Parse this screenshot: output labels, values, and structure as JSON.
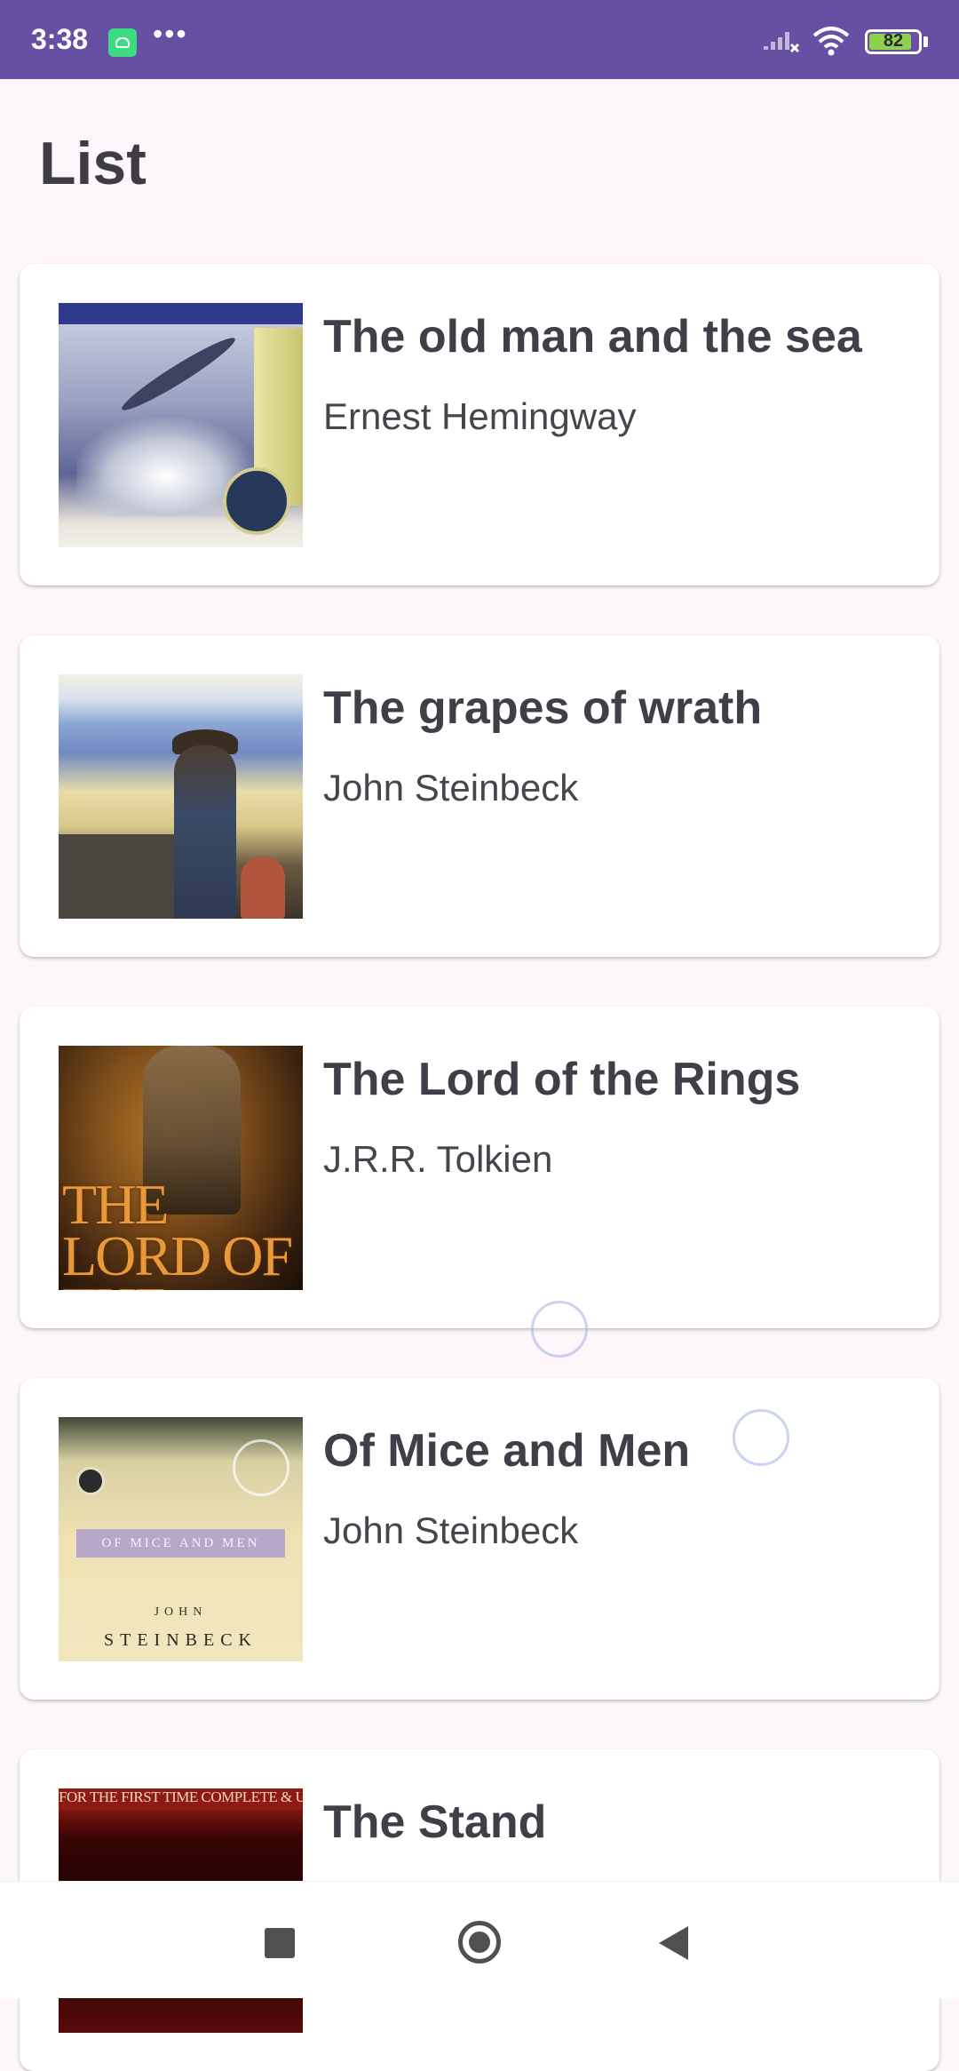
{
  "status_bar": {
    "time": "3:38",
    "overflow_indicator": "•••",
    "battery_level": "82",
    "icons": [
      "app-notification-icon",
      "signal-icon",
      "wifi-icon",
      "battery-icon"
    ]
  },
  "page": {
    "title": "List"
  },
  "books": [
    {
      "title": "The old man and the sea",
      "author": "Ernest Hemingway",
      "cover": "old-man-and-the-sea-cover"
    },
    {
      "title": "The grapes of wrath",
      "author": "John Steinbeck",
      "cover": "grapes-of-wrath-cover"
    },
    {
      "title": "The Lord of the Rings",
      "author": "J.R.R. Tolkien",
      "cover": "lord-of-the-rings-cover",
      "cover_text": "THE LORD OF THE RINGS"
    },
    {
      "title": "Of Mice and Men",
      "author": "John Steinbeck",
      "cover": "of-mice-and-men-cover",
      "cover_text": {
        "banner": "OF MICE AND MEN",
        "first_name": "JOHN",
        "last_name": "STEINBECK"
      }
    },
    {
      "title": "The Stand",
      "author": "",
      "cover": "the-stand-cover",
      "cover_text": "FOR THE FIRST TIME COMPLETE & UNCUT"
    }
  ],
  "navigation_bar": {
    "icons": [
      "recents-square-icon",
      "home-circle-icon",
      "back-triangle-icon"
    ]
  },
  "colors": {
    "status_bar": "#6750a4",
    "background": "#fdf7fb",
    "card": "#ffffff",
    "battery_fill": "#8fd14f"
  }
}
